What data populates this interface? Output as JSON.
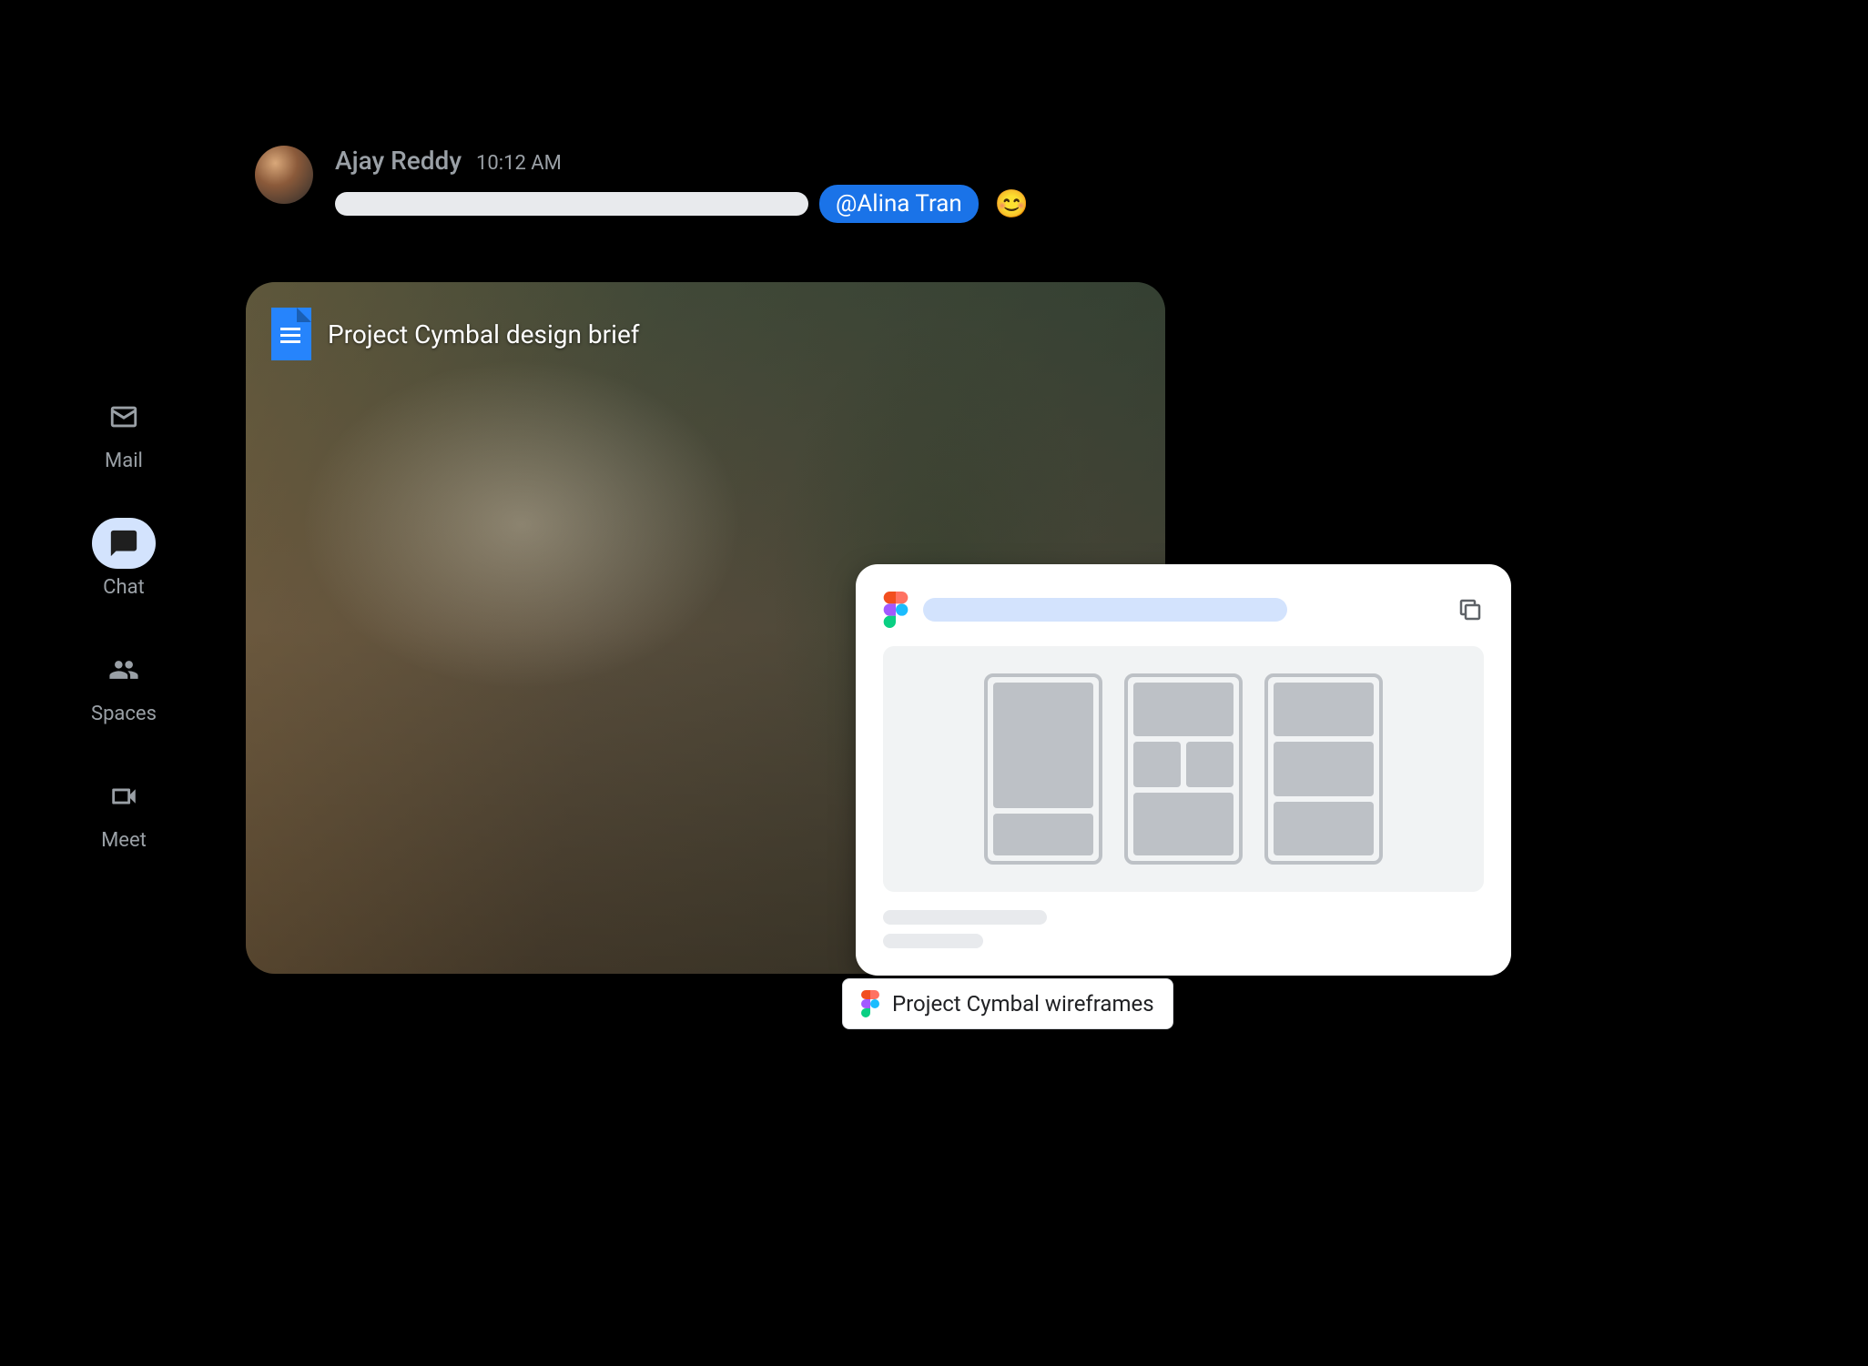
{
  "sidebar": {
    "items": [
      {
        "label": "Mail"
      },
      {
        "label": "Chat"
      },
      {
        "label": "Spaces"
      },
      {
        "label": "Meet"
      }
    ]
  },
  "message": {
    "sender": "Ajay Reddy",
    "timestamp": "10:12 AM",
    "mention": "@Alina Tran",
    "emoji": "😊"
  },
  "attachment": {
    "doc_title": "Project Cymbal design brief"
  },
  "figma": {
    "chip_label": "Project Cymbal wireframes"
  }
}
